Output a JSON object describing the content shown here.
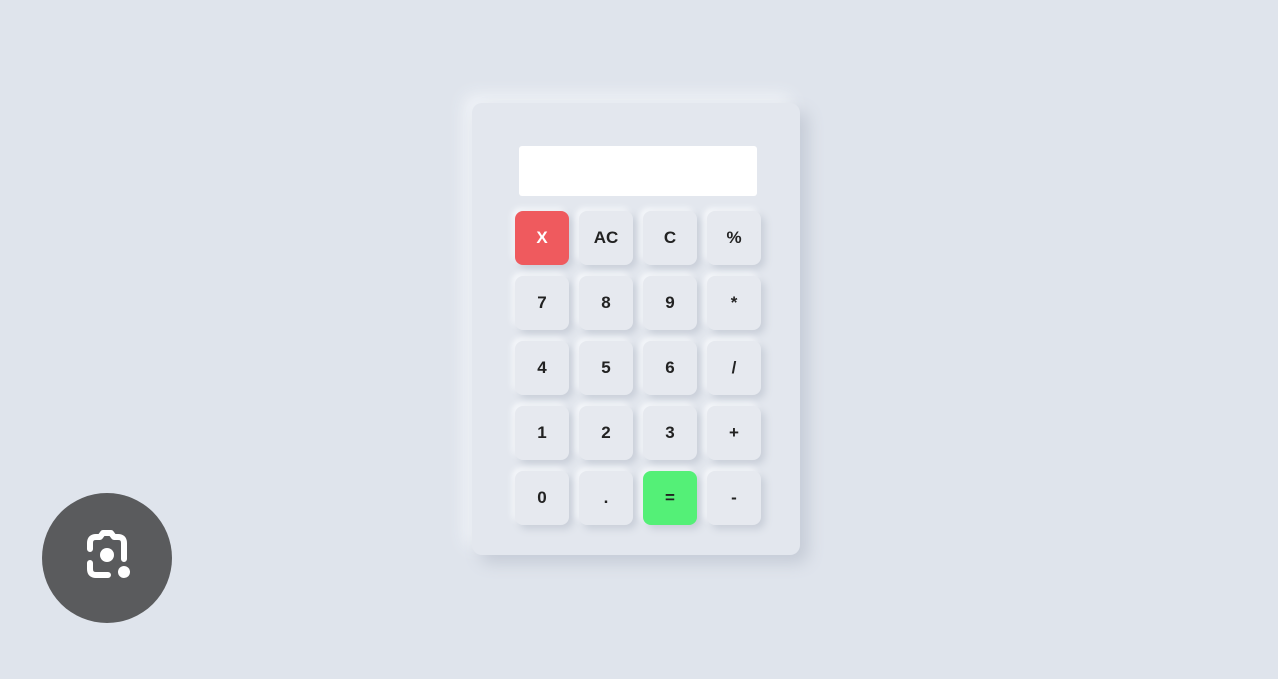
{
  "display": {
    "value": ""
  },
  "keys": [
    {
      "label": "X",
      "variant": "red"
    },
    {
      "label": "AC"
    },
    {
      "label": "C"
    },
    {
      "label": "%"
    },
    {
      "label": "7"
    },
    {
      "label": "8"
    },
    {
      "label": "9"
    },
    {
      "label": "*"
    },
    {
      "label": "4"
    },
    {
      "label": "5"
    },
    {
      "label": "6"
    },
    {
      "label": "/"
    },
    {
      "label": "1"
    },
    {
      "label": "2"
    },
    {
      "label": "3"
    },
    {
      "label": "+"
    },
    {
      "label": "0"
    },
    {
      "label": "."
    },
    {
      "label": "=",
      "variant": "green"
    },
    {
      "label": "-"
    }
  ],
  "colors": {
    "background": "#dfe4ec",
    "delete": "#ef5a5e",
    "equals": "#54f077",
    "lens": "#5a5b5d"
  },
  "overlay": {
    "icon": "google-lens-icon"
  }
}
